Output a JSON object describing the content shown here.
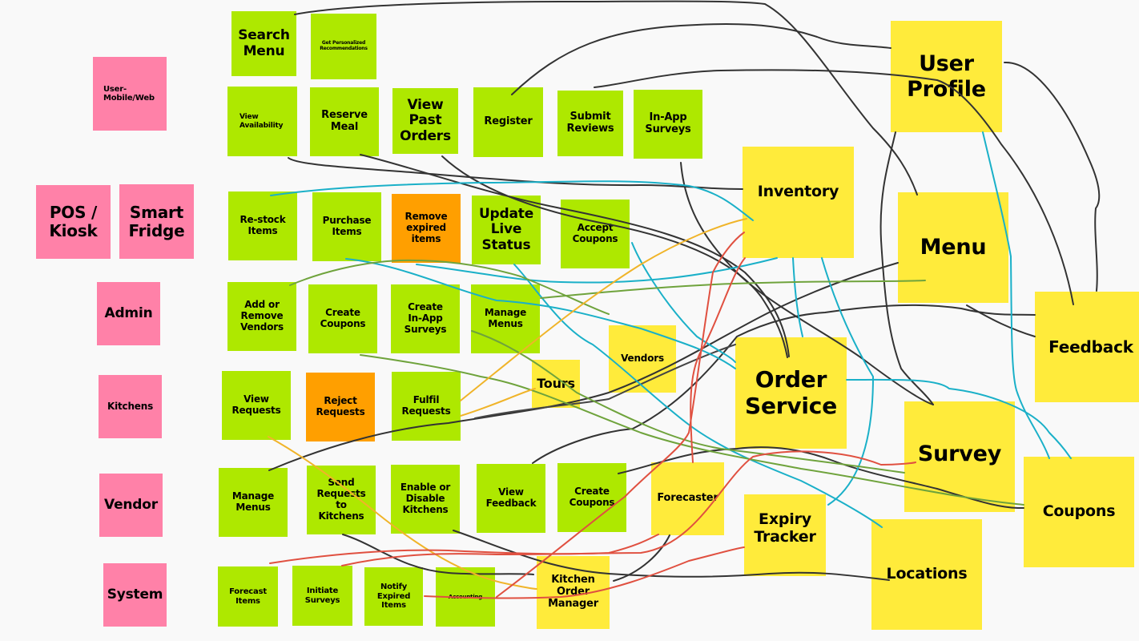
{
  "colors": {
    "background": "#f9f9f9",
    "actor": "#ff81a8",
    "feature": "#aee800",
    "negative_feature": "#ff9f00",
    "service": "#ffeb3b",
    "link_dark": "#333333",
    "link_cyan": "#1ab0c8",
    "link_green": "#6fa33c",
    "link_orange": "#f0b429",
    "link_red": "#e05040"
  },
  "actors": [
    {
      "id": "user",
      "label": "User-\nMobile/Web"
    },
    {
      "id": "pos",
      "label": "POS /\nKiosk"
    },
    {
      "id": "fridge",
      "label": "Smart\nFridge"
    },
    {
      "id": "admin",
      "label": "Admin"
    },
    {
      "id": "kitchens",
      "label": "Kitchens"
    },
    {
      "id": "vendor",
      "label": "Vendor"
    },
    {
      "id": "system",
      "label": "System"
    }
  ],
  "features": [
    {
      "id": "search-menu",
      "label": "Search\nMenu"
    },
    {
      "id": "recommend",
      "label": "Get Personalized\nRecommendations"
    },
    {
      "id": "view-availability",
      "label": "View\nAvailability"
    },
    {
      "id": "reserve-meal",
      "label": "Reserve\nMeal"
    },
    {
      "id": "view-past-orders",
      "label": "View\nPast\nOrders"
    },
    {
      "id": "register",
      "label": "Register"
    },
    {
      "id": "submit-reviews",
      "label": "Submit\nReviews"
    },
    {
      "id": "in-app-surveys",
      "label": "In-App\nSurveys"
    },
    {
      "id": "restock",
      "label": "Re-stock\nItems"
    },
    {
      "id": "purchase",
      "label": "Purchase\nItems"
    },
    {
      "id": "remove-expired",
      "label": "Remove\nexpired\nitems"
    },
    {
      "id": "update-live",
      "label": "Update\nLive\nStatus"
    },
    {
      "id": "accept-coupons",
      "label": "Accept\nCoupons"
    },
    {
      "id": "add-remove-vendors",
      "label": "Add or\nRemove\nVendors"
    },
    {
      "id": "admin-create-coupons",
      "label": "Create\nCoupons"
    },
    {
      "id": "create-surveys",
      "label": "Create\nIn-App\nSurveys"
    },
    {
      "id": "admin-manage-menus",
      "label": "Manage\nMenus"
    },
    {
      "id": "view-requests",
      "label": "View\nRequests"
    },
    {
      "id": "reject-requests",
      "label": "Reject\nRequests"
    },
    {
      "id": "fulfil-requests",
      "label": "Fulfil\nRequests"
    },
    {
      "id": "vendor-manage-menus",
      "label": "Manage\nMenus"
    },
    {
      "id": "send-requests",
      "label": "Send\nRequests\nto\nKitchens"
    },
    {
      "id": "enable-disable",
      "label": "Enable or\nDisable\nKitchens"
    },
    {
      "id": "view-feedback",
      "label": "View\nFeedback"
    },
    {
      "id": "vendor-create-coupons",
      "label": "Create\nCoupons"
    },
    {
      "id": "forecast-items",
      "label": "Forecast\nItems"
    },
    {
      "id": "initiate-surveys",
      "label": "Initiate\nSurveys"
    },
    {
      "id": "notify-expired",
      "label": "Notify\nExpired\nItems"
    },
    {
      "id": "accounting",
      "label": "Accounting"
    }
  ],
  "services": [
    {
      "id": "user-profile",
      "label": "User\nProfile"
    },
    {
      "id": "inventory",
      "label": "Inventory"
    },
    {
      "id": "menu",
      "label": "Menu"
    },
    {
      "id": "feedback",
      "label": "Feedback"
    },
    {
      "id": "order-service",
      "label": "Order\nService"
    },
    {
      "id": "vendors",
      "label": "Vendors"
    },
    {
      "id": "tours",
      "label": "Tours"
    },
    {
      "id": "survey",
      "label": "Survey"
    },
    {
      "id": "coupons",
      "label": "Coupons"
    },
    {
      "id": "forecaster",
      "label": "Forecaster"
    },
    {
      "id": "expiry-tracker",
      "label": "Expiry\nTracker"
    },
    {
      "id": "locations",
      "label": "Locations"
    },
    {
      "id": "kitchen-order-manager",
      "label": "Kitchen\nOrder\nManager"
    }
  ],
  "connections": [
    {
      "from": "search-menu",
      "to": "menu",
      "color": "dark"
    },
    {
      "from": "register",
      "to": "user-profile",
      "color": "dark"
    },
    {
      "from": "submit-reviews",
      "to": "feedback",
      "color": "dark"
    },
    {
      "from": "user-profile",
      "to": "feedback",
      "color": "dark"
    },
    {
      "from": "view-availability",
      "to": "inventory",
      "color": "dark"
    },
    {
      "from": "reserve-meal",
      "to": "order-service",
      "color": "dark"
    },
    {
      "from": "view-past-orders",
      "to": "order-service",
      "color": "dark"
    },
    {
      "from": "in-app-surveys",
      "to": "survey",
      "color": "dark"
    },
    {
      "from": "restock",
      "to": "inventory",
      "color": "cyan"
    },
    {
      "from": "purchase",
      "to": "order-service",
      "color": "cyan"
    },
    {
      "from": "update-live",
      "to": "locations",
      "color": "cyan"
    },
    {
      "from": "accept-coupons",
      "to": "coupons",
      "color": "cyan"
    },
    {
      "from": "add-remove-vendors",
      "to": "vendors",
      "color": "green"
    },
    {
      "from": "admin-create-coupons",
      "to": "coupons",
      "color": "green"
    },
    {
      "from": "create-surveys",
      "to": "survey",
      "color": "green"
    },
    {
      "from": "admin-manage-menus",
      "to": "menu",
      "color": "green"
    },
    {
      "from": "fulfil-requests",
      "to": "inventory",
      "color": "orange"
    },
    {
      "from": "fulfil-requests",
      "to": "tours",
      "color": "orange"
    },
    {
      "from": "send-requests",
      "to": "kitchen-order-manager",
      "color": "orange"
    },
    {
      "from": "vendor-manage-menus",
      "to": "menu",
      "color": "dark"
    },
    {
      "from": "view-feedback",
      "to": "feedback",
      "color": "dark"
    },
    {
      "from": "vendor-create-coupons",
      "to": "coupons",
      "color": "dark"
    },
    {
      "from": "forecast-items",
      "to": "forecaster",
      "color": "red"
    },
    {
      "from": "initiate-surveys",
      "to": "survey",
      "color": "red"
    },
    {
      "from": "notify-expired",
      "to": "expiry-tracker",
      "color": "red"
    },
    {
      "from": "accounting",
      "to": "inventory",
      "color": "red"
    },
    {
      "from": "forecaster",
      "to": "inventory",
      "color": "red"
    },
    {
      "from": "enable-disable",
      "to": "locations",
      "color": "dark"
    },
    {
      "from": "kitchen-order-manager",
      "to": "forecaster",
      "color": "dark"
    }
  ]
}
